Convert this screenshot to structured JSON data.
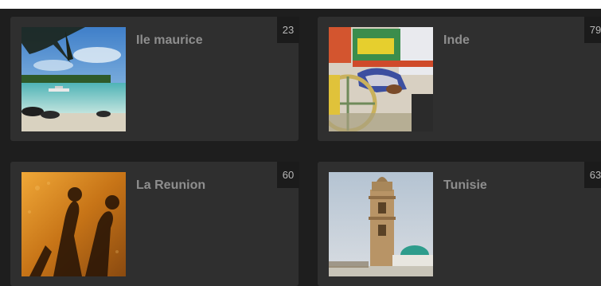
{
  "albums": [
    {
      "title": "Ile maurice",
      "count": "23",
      "thumb_icon": "beach-photo"
    },
    {
      "title": "Inde",
      "count": "79",
      "thumb_icon": "cart-photo"
    },
    {
      "title": "La Reunion",
      "count": "60",
      "thumb_icon": "shadow-photo"
    },
    {
      "title": "Tunisie",
      "count": "63",
      "thumb_icon": "minaret-photo"
    }
  ]
}
